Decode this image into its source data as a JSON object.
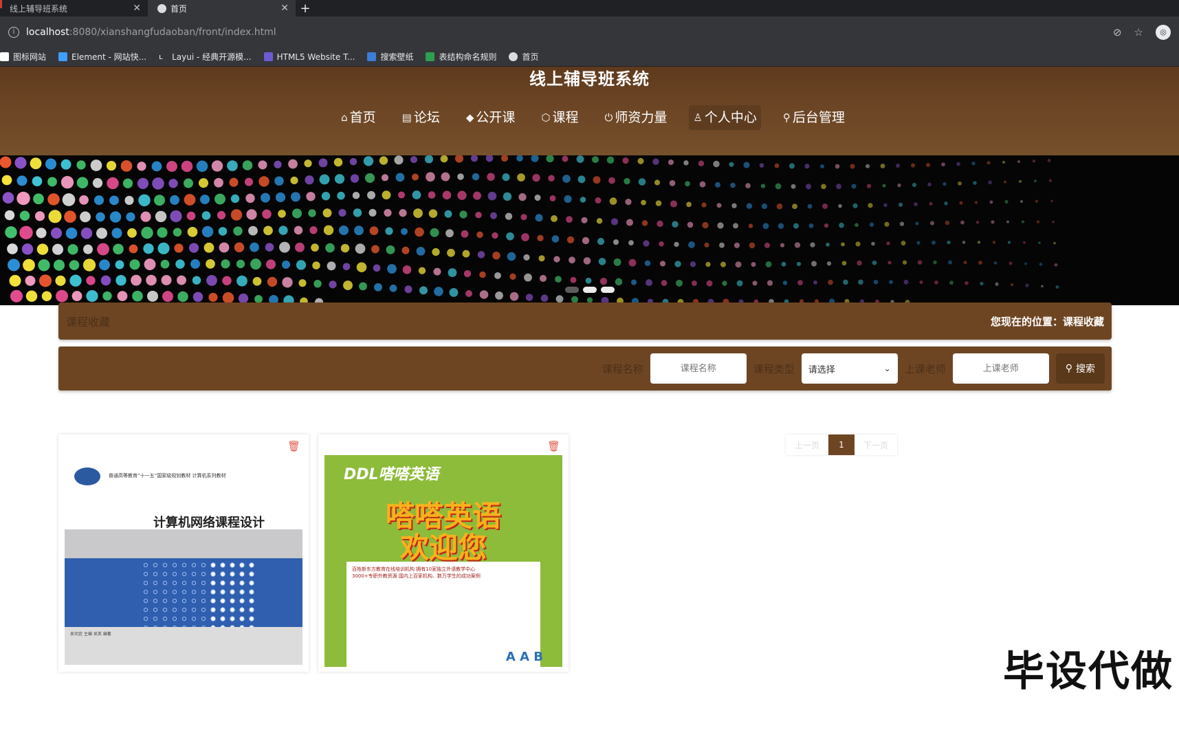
{
  "browser": {
    "tabs": [
      {
        "title": "线上辅导班系统",
        "active": false
      },
      {
        "title": "首页",
        "active": true
      }
    ],
    "new_tab": "+",
    "url_host": "localhost",
    "url_path": ":8080/xianshangfudaoban/front/index.html",
    "bookmarks": [
      {
        "label": "图标网站",
        "icon_color": "#ffffff"
      },
      {
        "label": "Element - 网站快...",
        "icon_color": "#409eff"
      },
      {
        "label": "Layui - 经典开源模...",
        "icon_color": "#ffffff"
      },
      {
        "label": "HTML5 Website T...",
        "icon_color": "#6b5bd2"
      },
      {
        "label": "搜索壁纸",
        "icon_color": "#3b7dd8"
      },
      {
        "label": "表结构命名规则",
        "icon_color": "#2e9e4f"
      },
      {
        "label": "首页",
        "icon_color": "#dadce0"
      }
    ]
  },
  "site": {
    "title": "线上辅导班系统",
    "nav": [
      {
        "label": "首页",
        "icon": "home-icon",
        "glyph": "⌂",
        "active": false
      },
      {
        "label": "论坛",
        "icon": "newspaper-icon",
        "glyph": "▤",
        "active": false
      },
      {
        "label": "公开课",
        "icon": "graduation-cap-icon",
        "glyph": "◆",
        "active": false
      },
      {
        "label": "课程",
        "icon": "cube-icon",
        "glyph": "⬡",
        "active": false
      },
      {
        "label": "师资力量",
        "icon": "power-icon",
        "glyph": "⏻",
        "active": false
      },
      {
        "label": "个人中心",
        "icon": "user-icon",
        "glyph": "♙",
        "active": true
      },
      {
        "label": "后台管理",
        "icon": "link-icon",
        "glyph": "⚲",
        "active": false
      }
    ]
  },
  "banner": {
    "slides": 3,
    "active_slide": 1
  },
  "crumb": {
    "title": "课程收藏",
    "location": "您现在的位置：课程收藏"
  },
  "search": {
    "name_label": "课程名称",
    "name_placeholder": "课程名称",
    "type_label": "课程类型",
    "type_value": "请选择",
    "teacher_label": "上课老师",
    "teacher_placeholder": "上课老师",
    "button_label": "搜索"
  },
  "cards": [
    {
      "series": "普通高等教育“十一五”国家级规划教材 计算机系列教材",
      "title": "计算机网络课程设计",
      "authors": "吴功宜 主编 吴英 编著"
    },
    {
      "brand": "DDL嗒嗒英语",
      "headline_1": "嗒嗒英语",
      "headline_2": "欢迎您",
      "paper_line_1": "百姓新东方教育在线培训机构 拥有10家独立外语教学中心",
      "paper_line_2": "3000+专职外教资源 国内上百家机构、数万学生的成功案例",
      "abc": "A A B"
    }
  ],
  "pagination": {
    "prev": "上一页",
    "current": "1",
    "next": "下一页"
  },
  "watermark": "毕设代做",
  "colors": {
    "brand_brown": "#6e4523",
    "header_brown": "#6b4424",
    "delete_red": "#e05a4f"
  }
}
